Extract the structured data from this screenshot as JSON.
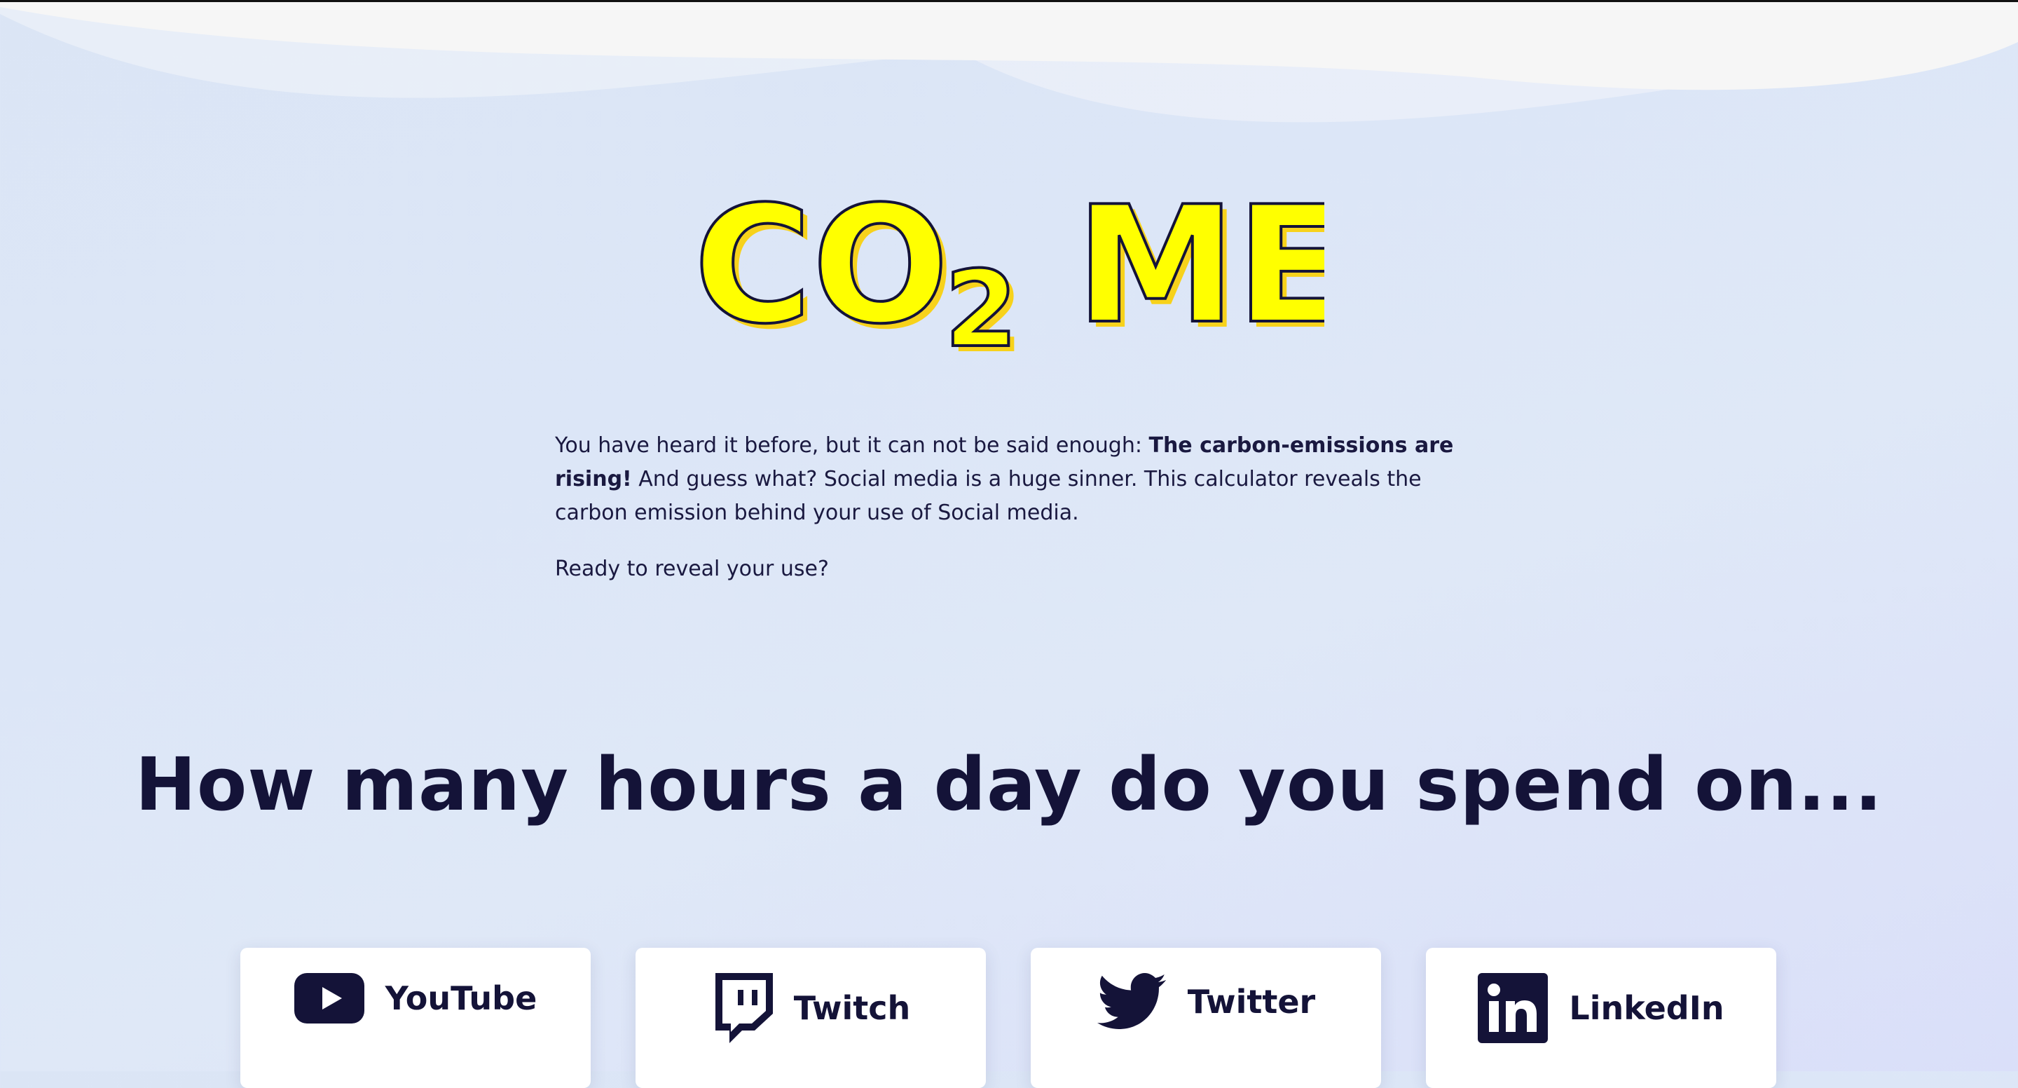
{
  "logo": {
    "text_main": "CO",
    "text_sub": "2",
    "text_after": "ME"
  },
  "intro": {
    "p1_before": "You have heard it before, but it can not be said enough: ",
    "p1_bold": "The carbon-emissions are rising!",
    "p1_after": " And guess what? Social media is a huge sinner. This calculator reveals the carbon emission behind your use of Social media.",
    "p2": "Ready to reveal your use?"
  },
  "question": "How many hours a day do you spend on...",
  "platforms": [
    {
      "label": "YouTube",
      "icon": "youtube-icon"
    },
    {
      "label": "Twitch",
      "icon": "twitch-icon"
    },
    {
      "label": "Twitter",
      "icon": "twitter-icon"
    },
    {
      "label": "LinkedIn",
      "icon": "linkedin-icon"
    }
  ],
  "colors": {
    "navy": "#141338",
    "yellow": "#ffff00",
    "yellow_shadow": "#f7d21b",
    "card": "#ffffff"
  }
}
